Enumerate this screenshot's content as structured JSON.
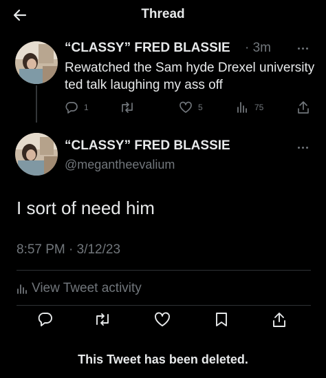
{
  "header": {
    "title": "Thread"
  },
  "tweet1": {
    "author_name": "“CLASSY” FRED BLASSIE",
    "separator": "·",
    "time": "3m",
    "text": "Rewatched the Sam hyde Drexel university ted talk laughing my ass off",
    "counts": {
      "replies": "1",
      "likes": "5",
      "views": "75"
    }
  },
  "tweet2": {
    "author_name": "“CLASSY” FRED BLASSIE",
    "handle": "@megantheevalium",
    "text": "I sort of need him",
    "timestamp": "8:57 PM · 3/12/23",
    "activity_label": "View Tweet activity"
  },
  "footer": {
    "deleted_notice": "This Tweet has been deleted."
  },
  "icons": [
    "back-arrow-icon",
    "more-icon",
    "reply-icon",
    "retweet-icon",
    "like-icon",
    "views-icon",
    "share-icon"
  ],
  "colors": {
    "background": "#000000",
    "text": "#e7e9ea",
    "muted": "#71767b",
    "divider": "#2f3336"
  }
}
